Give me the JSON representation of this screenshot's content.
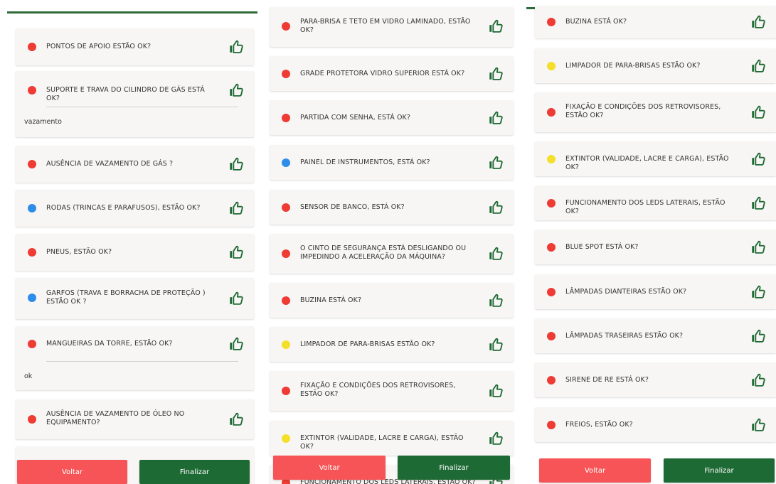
{
  "buttons": {
    "back": "Voltar",
    "finish": "Finalizar"
  },
  "colors": {
    "red": "#ee3b33",
    "blue": "#2d8de8",
    "yellow": "#f4df2a",
    "brand_green": "#1e6a34",
    "back_red": "#f65456"
  },
  "panel1": {
    "items": [
      {
        "label": "PONTOS DE APOIO ESTÃO OK?",
        "status": "red"
      },
      {
        "label": "SUPORTE E TRAVA DO CILINDRO DE GÁS ESTÁ OK?",
        "status": "red",
        "comment": "vazamento"
      },
      {
        "label": "AUSÊNCIA DE VAZAMENTO DE GÁS ?",
        "status": "red"
      },
      {
        "label": "RODAS (TRINCAS E PARAFUSOS), ESTÃO OK?",
        "status": "blue"
      },
      {
        "label": "PNEUS, ESTÃO OK?",
        "status": "red"
      },
      {
        "label": "GARFOS (TRAVA E BORRACHA DE PROTEÇÃO ) ESTÃO OK ?",
        "status": "blue"
      },
      {
        "label": "MANGUEIRAS DA TORRE, ESTÃO OK?",
        "status": "red",
        "comment": "ok"
      },
      {
        "label": "AUSÊNCIA DE VAZAMENTO DE ÓLEO NO EQUIPAMENTO?",
        "status": "red"
      }
    ]
  },
  "panel2": {
    "items": [
      {
        "label": "PARA-BRISA E TETO EM VIDRO LAMINADO, ESTÃO OK?",
        "status": "red"
      },
      {
        "label": "GRADE PROTETORA VIDRO SUPERIOR ESTÁ OK?",
        "status": "red"
      },
      {
        "label": "PARTIDA COM SENHA, ESTÁ OK?",
        "status": "red"
      },
      {
        "label": "PAINEL DE INSTRUMENTOS, ESTÁ OK?",
        "status": "blue"
      },
      {
        "label": "SENSOR DE BANCO, ESTÁ OK?",
        "status": "red"
      },
      {
        "label": "O CINTO DE SEGURANÇA ESTÁ DESLIGANDO OU IMPEDINDO A ACELERAÇÃO DA MÁQUINA?",
        "status": "red"
      },
      {
        "label": "BUZINA ESTÁ OK?",
        "status": "red"
      },
      {
        "label": "LIMPADOR DE PARA-BRISAS ESTÃO OK?",
        "status": "yellow"
      },
      {
        "label": "FIXAÇÃO E CONDIÇÕES DOS RETROVISORES, ESTÃO OK?",
        "status": "red"
      },
      {
        "label": "EXTINTOR (VALIDADE, LACRE E CARGA), ESTÃO OK?",
        "status": "yellow"
      },
      {
        "label": "FUNCIONAMENTO DOS LEDS LATERAIS, ESTÃO OK?",
        "status": "red"
      }
    ]
  },
  "panel3": {
    "items": [
      {
        "label": "BUZINA ESTÁ OK?",
        "status": "red"
      },
      {
        "label": "LIMPADOR DE PARA-BRISAS ESTÃO OK?",
        "status": "yellow"
      },
      {
        "label": "FIXAÇÃO E CONDIÇÕES DOS RETROVISORES, ESTÃO OK?",
        "status": "red"
      },
      {
        "label": "EXTINTOR (VALIDADE, LACRE E CARGA), ESTÃO OK?",
        "status": "yellow"
      },
      {
        "label": "FUNCIONAMENTO DOS LEDS LATERAIS, ESTÃO OK?",
        "status": "red"
      },
      {
        "label": "BLUE SPOT ESTÁ OK?",
        "status": "red"
      },
      {
        "label": "LÂMPADAS DIANTEIRAS ESTÃO OK?",
        "status": "red"
      },
      {
        "label": "LÂMPADAS TRASEIRAS ESTÃO OK?",
        "status": "red"
      },
      {
        "label": "SIRENE DE RE ESTÁ OK?",
        "status": "red"
      },
      {
        "label": "FREIOS, ESTÃO OK?",
        "status": "red"
      }
    ]
  }
}
